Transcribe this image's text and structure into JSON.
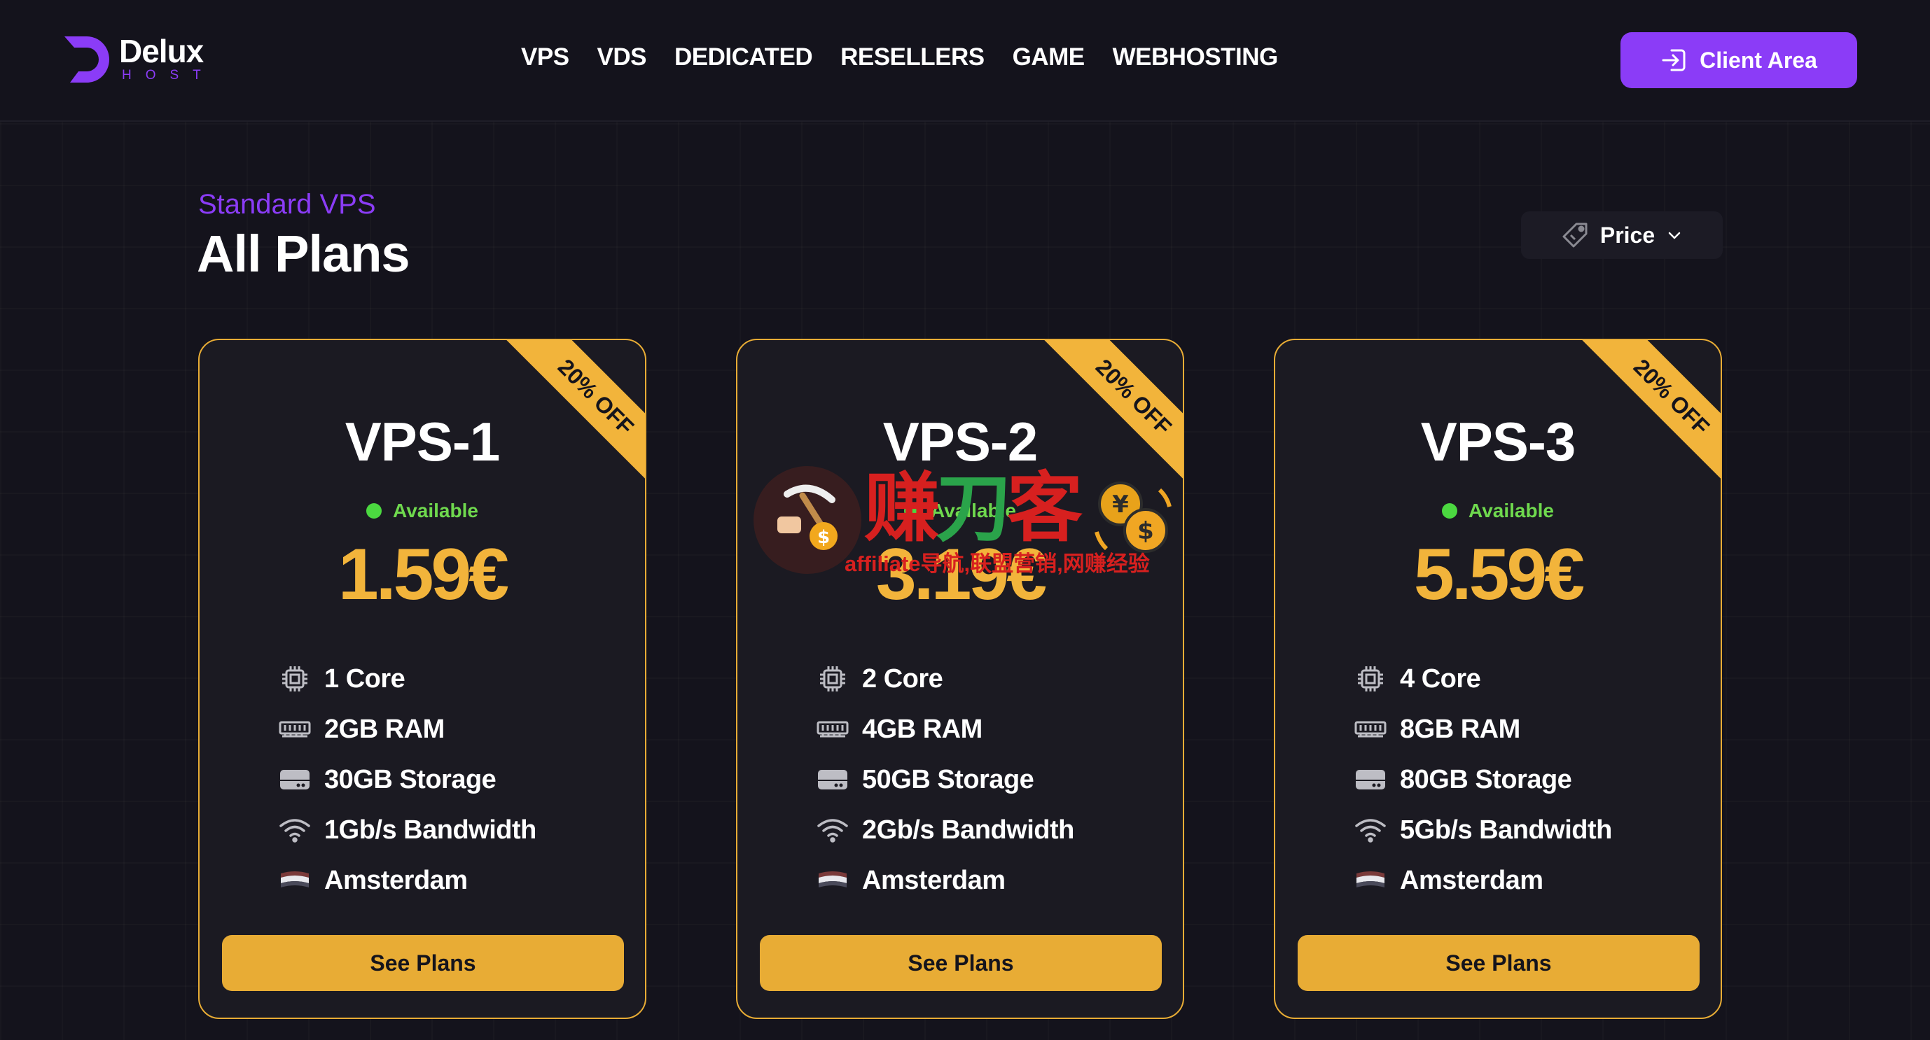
{
  "header": {
    "logo_name": "Delux",
    "logo_sub": "HOST",
    "nav": [
      "VPS",
      "VDS",
      "DEDICATED",
      "RESELLERS",
      "GAME",
      "WEBHOSTING"
    ],
    "client_area_label": "Client Area",
    "client_area_icon": "login-icon"
  },
  "section": {
    "subtitle": "Standard VPS",
    "title": "All Plans",
    "sort_label": "Price",
    "sort_icon": "price-tag-icon"
  },
  "colors": {
    "accent_purple": "#8b3cf7",
    "accent_gold": "#e8ac35",
    "available_green": "#4bd840",
    "background": "#14131c",
    "card_background": "#1b1a22"
  },
  "plans": [
    {
      "badge": "20% OFF",
      "name": "VPS-1",
      "status": "Available",
      "price": "1.59€",
      "specs": [
        "1 Core",
        "2GB RAM",
        "30GB Storage",
        "1Gb/s Bandwidth",
        "Amsterdam"
      ],
      "cta": "See Plans"
    },
    {
      "badge": "20% OFF",
      "name": "VPS-2",
      "status": "Available",
      "price": "3.19€",
      "specs": [
        "2 Core",
        "4GB RAM",
        "50GB Storage",
        "2Gb/s Bandwidth",
        "Amsterdam"
      ],
      "cta": "See Plans"
    },
    {
      "badge": "20% OFF",
      "name": "VPS-3",
      "status": "Available",
      "price": "5.59€",
      "specs": [
        "4 Core",
        "8GB RAM",
        "80GB Storage",
        "5Gb/s Bandwidth",
        "Amsterdam"
      ],
      "cta": "See Plans"
    }
  ],
  "spec_icons": [
    "cpu-icon",
    "ram-icon",
    "storage-icon",
    "wifi-icon",
    "flag-icon"
  ],
  "watermark": {
    "title_1": "赚",
    "title_2": "刀",
    "title_3": "客",
    "subtitle": "affiliate导航,联盟营销,网赚经验"
  }
}
